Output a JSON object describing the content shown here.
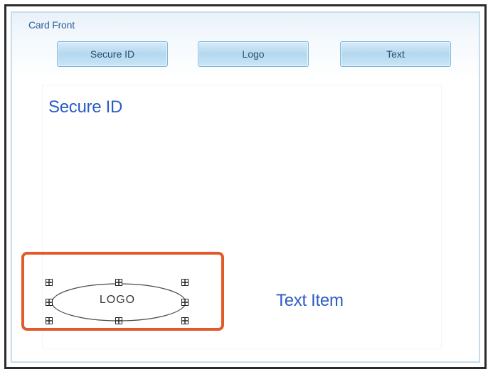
{
  "panel": {
    "title": "Card Front"
  },
  "toolbar": {
    "buttons": [
      {
        "label": "Secure ID"
      },
      {
        "label": "Logo"
      },
      {
        "label": "Text"
      }
    ]
  },
  "canvas": {
    "secure_id_text": "Secure ID",
    "logo_text": "LOGO",
    "text_item": "Text Item"
  },
  "colors": {
    "accent_blue": "#2c5cc5",
    "highlight_orange": "#e4592a"
  }
}
